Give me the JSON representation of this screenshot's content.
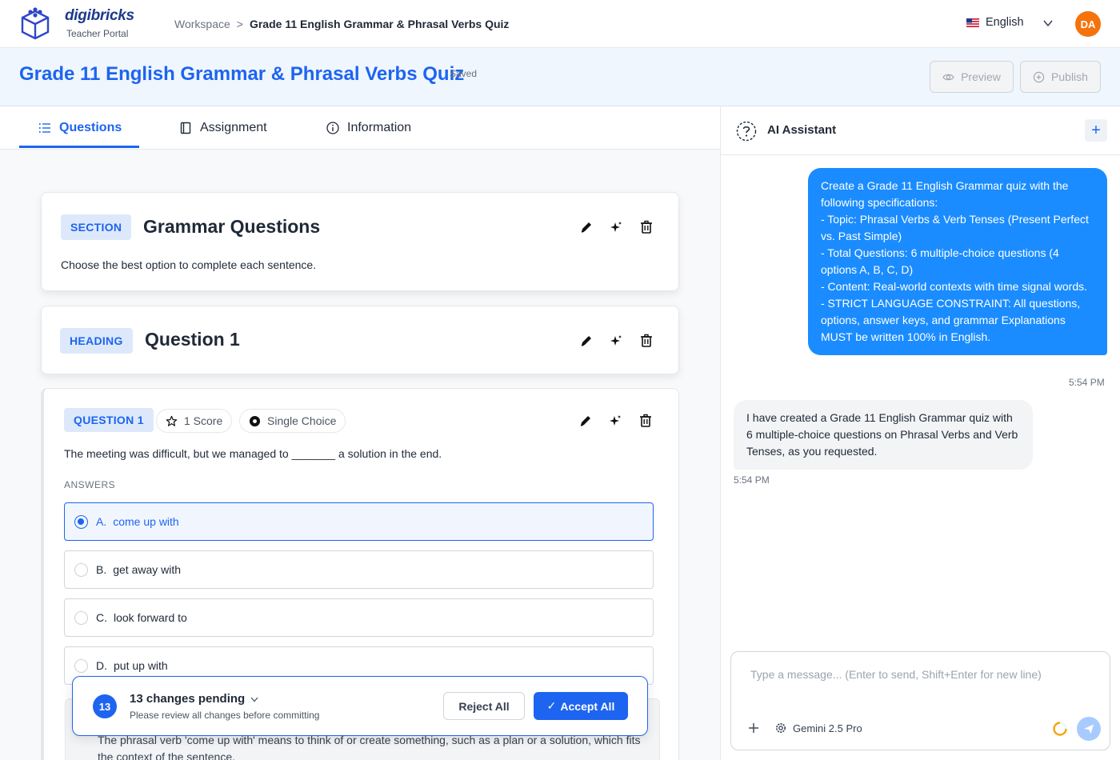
{
  "app": {
    "brand": "digibricks",
    "subtitle": "Teacher Portal"
  },
  "breadcrumb": {
    "root": "Workspace",
    "separator": ">",
    "current": "Grade 11 English Grammar & Phrasal Verbs Quiz"
  },
  "language": {
    "label": "English",
    "flag_icon": "us-flag-icon"
  },
  "user": {
    "initials": "DA",
    "color": "#f5730b"
  },
  "header": {
    "title": "Grade 11 English Grammar & Phrasal Verbs Quiz",
    "status": "Saved",
    "preview_label": "Preview",
    "publish_label": "Publish"
  },
  "tabs": [
    {
      "label": "Questions",
      "icon": "list-icon",
      "active": true
    },
    {
      "label": "Assignment",
      "icon": "book-icon",
      "active": false
    },
    {
      "label": "Information",
      "icon": "info-icon",
      "active": false
    }
  ],
  "section": {
    "badge": "SECTION",
    "title": "Grammar Questions",
    "description": "Choose the best option to complete each sentence."
  },
  "heading": {
    "badge": "HEADING",
    "title": "Question 1"
  },
  "question": {
    "badge": "QUESTION 1",
    "score_label": "1 Score",
    "type_label": "Single Choice",
    "text": "The meeting was difficult, but we managed to _______ a solution in the end.",
    "answers_label": "ANSWERS",
    "answers": [
      {
        "letter": "A.",
        "text": "come up with",
        "selected": true
      },
      {
        "letter": "B.",
        "text": "get away with",
        "selected": false
      },
      {
        "letter": "C.",
        "text": "look forward to",
        "selected": false
      },
      {
        "letter": "D.",
        "text": "put up with",
        "selected": false
      }
    ],
    "explanation": "The phrasal verb 'come up with' means to think of or create something, such as a plan or a solution, which fits the context of the sentence."
  },
  "pending": {
    "count": "13",
    "title": "13 changes pending",
    "subtitle": "Please review all changes before committing",
    "reject_label": "Reject All",
    "accept_label": "Accept All"
  },
  "assistant": {
    "title": "AI Assistant",
    "messages": [
      {
        "role": "user",
        "text": "Create a Grade 11 English Grammar quiz with the following specifications:\n- Topic: Phrasal Verbs & Verb Tenses (Present Perfect vs. Past Simple)\n- Total Questions: 6 multiple-choice questions (4 options A, B, C, D)\n- Content: Real-world contexts with time signal words.\n- STRICT LANGUAGE CONSTRAINT: All questions, options, answer keys, and grammar Explanations MUST be written 100% in English.",
        "time": "5:54 PM"
      },
      {
        "role": "assistant",
        "text": "I have created a Grade 11 English Grammar quiz with 6 multiple-choice questions on Phrasal Verbs and Verb Tenses, as you requested.",
        "time": "5:54 PM"
      }
    ],
    "input_placeholder": "Type a message... (Enter to send, Shift+Enter for new line)",
    "model": "Gemini 2.5 Pro"
  },
  "colors": {
    "accent": "#1d64f0",
    "user_bubble": "#1a8cff",
    "title_bar_bg": "#eff6fd"
  }
}
